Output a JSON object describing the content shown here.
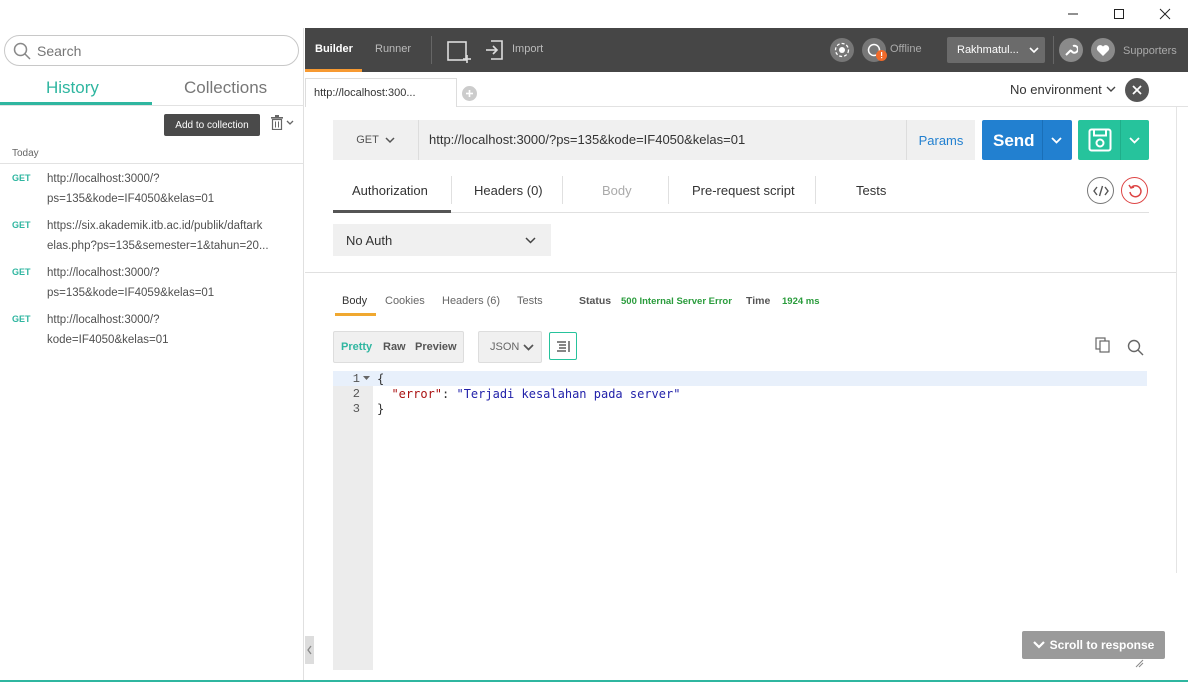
{
  "window": {
    "controls": [
      "minimize-icon",
      "maximize-icon",
      "close-icon"
    ]
  },
  "sidebar": {
    "search_placeholder": "Search",
    "tabs": {
      "history": "History",
      "collections": "Collections"
    },
    "add_to_collection": "Add to collection",
    "section_today": "Today",
    "history": [
      {
        "method": "GET",
        "line1": "http://localhost:3000/?",
        "line2": "ps=135&kode=IF4050&kelas=01"
      },
      {
        "method": "GET",
        "line1": "https://six.akademik.itb.ac.id/publik/daftark",
        "line2": "elas.php?ps=135&semester=1&tahun=20..."
      },
      {
        "method": "GET",
        "line1": "http://localhost:3000/?",
        "line2": "ps=135&kode=IF4059&kelas=01"
      },
      {
        "method": "GET",
        "line1": "http://localhost:3000/?",
        "line2": "kode=IF4050&kelas=01"
      }
    ]
  },
  "topbar": {
    "builder": "Builder",
    "runner": "Runner",
    "import": "Import",
    "offline": "Offline",
    "user": "Rakhmatul...",
    "supporters": "Supporters"
  },
  "tabstrip": {
    "active_tab": "http://localhost:300...",
    "environment": "No environment"
  },
  "request": {
    "method": "GET",
    "url": "http://localhost:3000/?ps=135&kode=IF4050&kelas=01",
    "params": "Params",
    "send": "Send",
    "tabs": [
      "Authorization",
      "Headers (0)",
      "Body",
      "Pre-request script",
      "Tests"
    ],
    "auth_type": "No Auth"
  },
  "response": {
    "tabs": [
      "Body",
      "Cookies",
      "Headers (6)",
      "Tests"
    ],
    "status_label": "Status",
    "status_value": "500 Internal Server Error",
    "time_label": "Time",
    "time_value": "1924 ms",
    "formats": [
      "Pretty",
      "Raw",
      "Preview"
    ],
    "language": "JSON",
    "code_lines": [
      "{",
      "  \"error\": \"Terjadi kesalahan pada server\"",
      "}"
    ],
    "json_key": "\"error\"",
    "json_value": "\"Terjadi kesalahan pada server\"",
    "line_numbers": [
      "1",
      "2",
      "3"
    ],
    "scroll_to_response": "Scroll to response"
  },
  "colors": {
    "accent_green": "#2fb6a0",
    "send_blue": "#2280d0",
    "save_green": "#26c39c",
    "builder_orange": "#f79a32",
    "status_green": "#2a9c3c"
  }
}
